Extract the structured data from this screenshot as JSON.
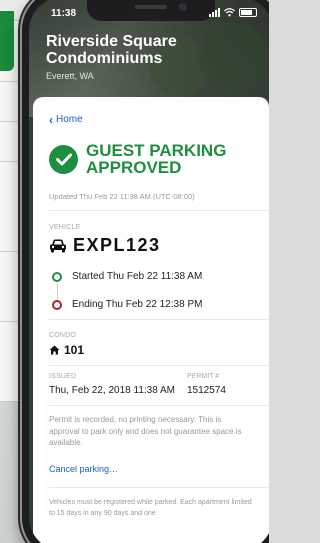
{
  "status_bar": {
    "time": "11:38"
  },
  "header": {
    "title": "Riverside Square Condominiums",
    "location": "Everett, WA"
  },
  "nav": {
    "back_label": "Home"
  },
  "approval": {
    "status": "GUEST PARKING APPROVED",
    "updated": "Updated Thu Feb 22 11:38 AM (UTC-08:00)"
  },
  "vehicle": {
    "label": "VEHICLE",
    "plate": "EXPL123",
    "started": "Started Thu Feb 22 11:38 AM",
    "ending": "Ending Thu Feb 22 12:38 PM"
  },
  "condo": {
    "label": "CONDO",
    "unit": "101"
  },
  "issued": {
    "label": "ISSUED",
    "value": "Thu, Feb 22, 2018 11:38 AM"
  },
  "permit": {
    "label": "PERMIT #",
    "value": "1512574"
  },
  "note": "Permit is recorded, no printing necessary. This is approval to park only and does not guarantee space is available.",
  "cancel_label": "Cancel parking…",
  "footer_note": "Vehicles must be registered while parked. Each apartment limited to 15 days in any 90 days and one",
  "icons": [
    "check-icon",
    "chevron-left-icon",
    "car-icon",
    "home-icon",
    "signal-icon",
    "wifi-icon",
    "battery-icon"
  ],
  "colors": {
    "accent": "#1f8f3f",
    "link": "#1a63c4",
    "ending": "#b11f2d"
  }
}
